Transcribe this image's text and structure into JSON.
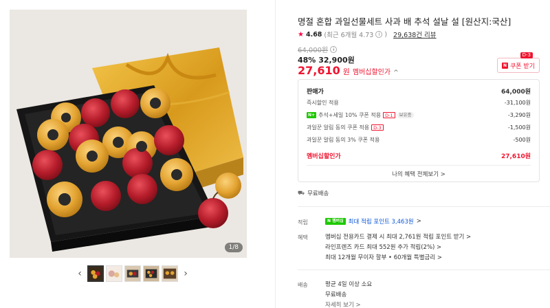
{
  "gallery": {
    "page_indicator": "1/8",
    "thumbnails": [
      "thumb-1",
      "thumb-2",
      "thumb-3",
      "thumb-4",
      "thumb-5"
    ],
    "prev_arrow": "‹",
    "next_arrow": "›"
  },
  "product": {
    "title": "명절 혼합 과일선물세트 사과 배 추석 설날 설 [원산지:국산]",
    "rating": {
      "star": "★",
      "score": "4.68",
      "recent": "(최근 6개월 4.73",
      "recent_close": ")",
      "review_count": "29,638건 리뷰"
    },
    "original_price": "64,000원",
    "discount_rate": "48%",
    "sale_price": "32,900원",
    "member_price_num": "27,610",
    "member_price_unit": "원",
    "member_price_label": "멤버십할인가",
    "member_price_chevron": "^"
  },
  "coupon": {
    "day_tag": "D-3",
    "badge": "N",
    "label": "쿠폰 받기"
  },
  "breakdown": {
    "head_label": "판매가",
    "head_amount": "64,000원",
    "rows": [
      {
        "label": "즉시할인 적용",
        "amount": "-31,100원"
      },
      {
        "badge": "N+",
        "label": "추석+세일 10% 쿠폰 적용",
        "tag": "D-1",
        "tag2": "보유중",
        "amount": "-3,290원"
      },
      {
        "label": "과일꾼 알림 동의 쿠폰 적용",
        "tag": "D-3",
        "amount": "-1,500원"
      },
      {
        "label": "과일꾼 알림 동의 3% 쿠폰 적용",
        "amount": "-500원"
      }
    ],
    "total_label": "멤버십할인가",
    "total_amount": "27,610원",
    "all_benefits": "나의 혜택 전체보기 >"
  },
  "shipping_free": "무료배송",
  "points": {
    "label": "적립",
    "badge": "N 멤버십",
    "text": "최대 적립 포인트 3,463원",
    "chev": ">"
  },
  "benefits": {
    "label": "혜택",
    "lines": [
      "멤버십 전용카드 결제 시 최대 2,761원 적립 포인트 받기 >",
      "라인프렌즈 카드 최대 552원 추가 적립(2%) >",
      "최대 12개월 무이자 할부 • 60개월 특별금리 >"
    ]
  },
  "delivery": {
    "label": "배송",
    "line1": "평균 4일 이상 소요",
    "line2": "무료배송",
    "line3": "자세히 보기 >"
  },
  "colors": {
    "accent_red": "#f0142f",
    "naver_green": "#1ec800",
    "link_blue": "#0a56d8"
  }
}
